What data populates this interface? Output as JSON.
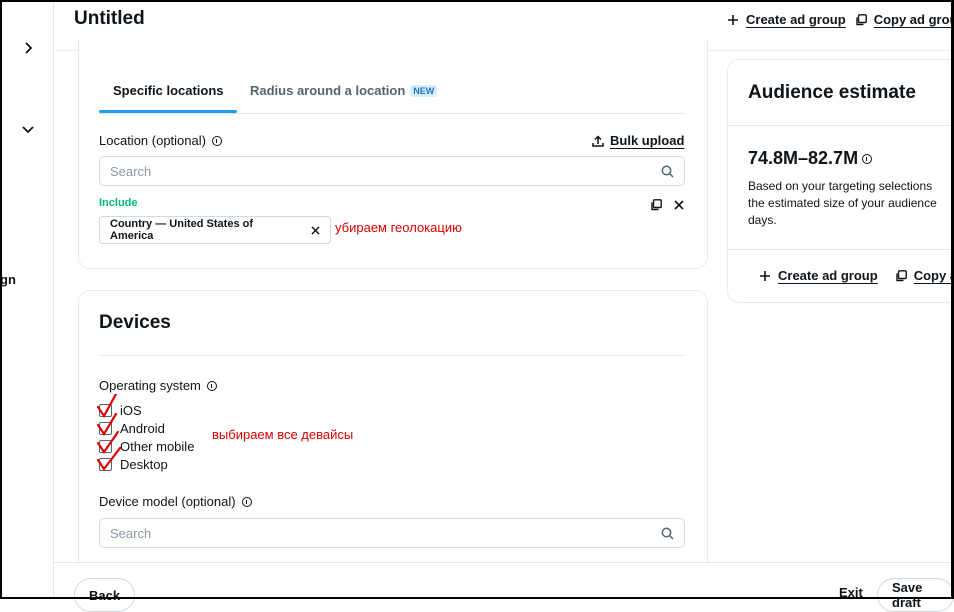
{
  "header": {
    "title": "Untitled",
    "create_ad_group": "Create ad group",
    "copy_ad_group": "Copy ad grou"
  },
  "sidebar": {
    "partial_label": "gn",
    "icons": [
      "chevron-right-icon",
      "chevron-down-icon"
    ]
  },
  "locations": {
    "tabs": [
      {
        "label": "Specific locations",
        "active": true
      },
      {
        "label": "Radius around a location",
        "badge": "NEW",
        "active": false
      }
    ],
    "location_label": "Location (optional)",
    "bulk_upload": "Bulk upload",
    "search_placeholder": "Search",
    "include_label": "Include",
    "chip_text": "Country — United States of America",
    "annotation": "убираем геолокацию"
  },
  "devices": {
    "title": "Devices",
    "os_label": "Operating system",
    "os_options": [
      "iOS",
      "Android",
      "Other mobile",
      "Desktop"
    ],
    "annotation": "выбираем все девайсы",
    "device_model_label": "Device model (optional)",
    "device_search_placeholder": "Search"
  },
  "audience": {
    "title": "Audience estimate",
    "range": "74.8M–82.7M",
    "description": "Based on your targeting selections, the estimated size of your audience days.",
    "desc_lines": [
      "Based on your targeting selections",
      "the estimated size of your audience",
      "days."
    ],
    "create_ad_group": "Create ad group",
    "copy": "Copy a"
  },
  "footer": {
    "back": "Back",
    "exit": "Exit",
    "save_draft": "Save draft"
  },
  "colors": {
    "accent": "#1d9bf0",
    "include_green": "#00ba7c",
    "annotation_red": "#e00000",
    "badge_bg": "#d9efff"
  }
}
